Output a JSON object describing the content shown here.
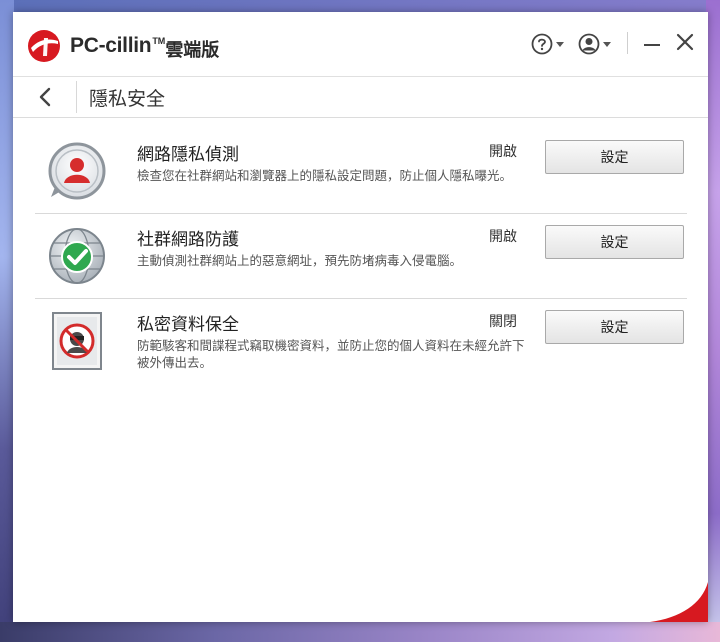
{
  "app": {
    "name": "PC-cillin",
    "tm": "TM",
    "suffix": "雲端版"
  },
  "titlebar": {
    "help_icon": "question-circle-icon",
    "account_icon": "user-circle-icon",
    "minimize_icon": "minimize-icon",
    "close_icon": "close-icon"
  },
  "page": {
    "title": "隱私安全",
    "back_icon": "chevron-left-icon"
  },
  "features": [
    {
      "title": "網路隱私偵測",
      "status": "開啟",
      "description": "檢查您在社群網站和瀏覽器上的隱私設定問題，防止個人隱私曝光。",
      "button": "設定",
      "icon": "privacy-scanner-icon"
    },
    {
      "title": "社群網路防護",
      "status": "開啟",
      "description": "主動偵測社群網站上的惡意網址，預先防堵病毒入侵電腦。",
      "button": "設定",
      "icon": "globe-check-icon"
    },
    {
      "title": "私密資料保全",
      "status": "關閉",
      "description": "防範駭客和間諜程式竊取機密資料，並防止您的個人資料在未經允許下被外傳出去。",
      "button": "設定",
      "icon": "data-theft-prevention-icon"
    }
  ],
  "colors": {
    "brand_red": "#d71920",
    "window_bg": "#ffffff"
  }
}
